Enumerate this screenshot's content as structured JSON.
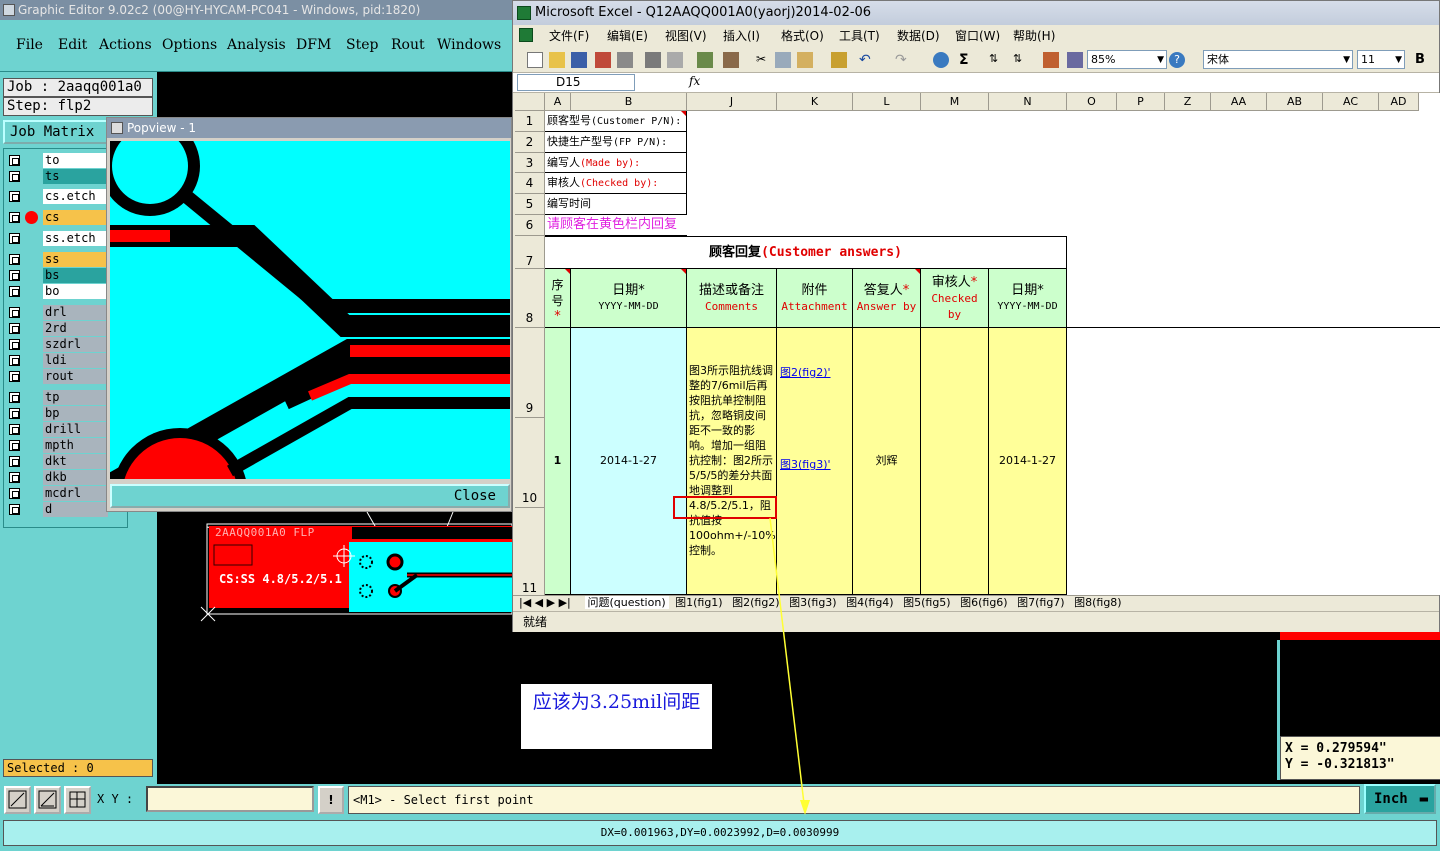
{
  "graphic_editor": {
    "title": "Graphic Editor 9.02c2 (00@HY-HYCAM-PC041 - Windows, pid:1820)",
    "menu": [
      "File",
      "Edit",
      "Actions",
      "Options",
      "Analysis",
      "DFM",
      "Step",
      "Rout",
      "Windows"
    ],
    "job_label": "Job : 2aaqq001a0",
    "step_label": "Step: flp2",
    "job_matrix_label": "Job Matrix",
    "layers": [
      {
        "name": "to",
        "color": "#ffffff"
      },
      {
        "name": "ts",
        "color": "#2aa39f"
      },
      {
        "name": "cs.etch",
        "color": "#ffffff"
      },
      {
        "name": "cs",
        "color": "#f6c24a",
        "active": true
      },
      {
        "name": "ss.etch",
        "color": "#ffffff"
      },
      {
        "name": "ss",
        "color": "#f6c24a"
      },
      {
        "name": "bs",
        "color": "#2aa39f"
      },
      {
        "name": "bo",
        "color": "#ffffff"
      },
      {
        "name": "drl",
        "color": "#a9b4bd"
      },
      {
        "name": "2rd",
        "color": "#a9b4bd"
      },
      {
        "name": "szdrl",
        "color": "#a9b4bd"
      },
      {
        "name": "ldi",
        "color": "#a9b4bd"
      },
      {
        "name": "rout",
        "color": "#a9b4bd"
      },
      {
        "name": "tp",
        "color": "#a9b4bd"
      },
      {
        "name": "bp",
        "color": "#a9b4bd"
      },
      {
        "name": "drill",
        "color": "#a9b4bd"
      },
      {
        "name": "mpth",
        "color": "#a9b4bd"
      },
      {
        "name": "dkt",
        "color": "#a9b4bd"
      },
      {
        "name": "dkb",
        "color": "#a9b4bd"
      },
      {
        "name": "mcdrl",
        "color": "#a9b4bd"
      },
      {
        "name": "d",
        "color": "#a9b4bd"
      }
    ],
    "selected_label": "Selected : 0",
    "popview_title": "Popview - 1",
    "popview_close": "Close",
    "board_silkscreen_1": "2AAQQ001A0 FLP",
    "board_silkscreen_2": "CS:SS 4.8/5.2/5.1",
    "xy_label": "X Y :",
    "xy_value": "",
    "bang_label": "!",
    "prompt": "<M1> - Select first point",
    "unit": "Inch",
    "status": "DX=0.001963,DY=0.0023992,D=0.0030999",
    "coord_x": "X = 0.279594\"",
    "coord_y": "Y = -0.321813\"",
    "note": "应该为3.25mil间距"
  },
  "excel": {
    "title": "Microsoft Excel - Q12AAQQ001A0(yaorj)2014-02-06",
    "menu": [
      "文件(F)",
      "编辑(E)",
      "视图(V)",
      "插入(I)",
      "格式(O)",
      "工具(T)",
      "数据(D)",
      "窗口(W)",
      "帮助(H)"
    ],
    "zoom": "85%",
    "font_name": "宋体",
    "font_size": "11",
    "bold_label": "B",
    "name_box": "D15",
    "fx": "fx",
    "columns": [
      "A",
      "B",
      "J",
      "K",
      "L",
      "M",
      "N",
      "O",
      "P",
      "Z",
      "AA",
      "AB",
      "AC",
      "AD"
    ],
    "rows": [
      "1",
      "2",
      "3",
      "4",
      "5",
      "6",
      "7",
      "8",
      "9",
      "10",
      "11"
    ],
    "info_labels": {
      "r1_a": "顾客型号",
      "r1_b": "(Customer P/N):",
      "r2_a": "快捷生产型号",
      "r2_b": "(FP P/N):",
      "r3_a": "编写人",
      "r3_b": "(Made by):",
      "r4_a": "审核人",
      "r4_b": "(Checked by):",
      "r5": "编写时间",
      "r6": "请顾客在黄色栏内回复"
    },
    "answers_title_cn": "顾客回复",
    "answers_title_en": "(Customer answers)",
    "headers": {
      "seq": "序号",
      "date_cn": "日期*",
      "date_fmt": "YYYY-MM-DD",
      "desc_cn": "描述或备注",
      "desc_en": "Comments",
      "att_cn": "附件",
      "att_en": "Attachment",
      "ans_cn": "答复人",
      "ans_en": "Answer by",
      "chk_cn": "审核人",
      "chk_en": "Checked by",
      "date2_cn": "日期*",
      "date2_fmt": "YYYY-MM-DD"
    },
    "row": {
      "seq": "1",
      "date": "2014-1-27",
      "comment_part1": "图3所示阻抗线调整的7/6mil后再按阻抗单控制阻抗，忽略铜皮间距不一致的影响。增加一组阻抗控制：图2所示5/5/5的差分共面地调整到",
      "comment_highlight": "4.8/5.2/5.1，",
      "comment_part2": "阻抗值按100ohm+/-10%控制。",
      "att1": "图2(fig2)'",
      "att2": "图3(fig3)'",
      "answer_by": "刘辉",
      "date2": "2014-1-27"
    },
    "tabs": [
      "问题(question)",
      "图1(fig1)",
      "图2(fig2)",
      "图3(fig3)",
      "图4(fig4)",
      "图5(fig5)",
      "图6(fig6)",
      "图7(fig7)",
      "图8(fig8)"
    ],
    "status": "就绪"
  },
  "colors": {
    "genesis_cyan": "#6ed3d0",
    "board_cyan": "#00ffff",
    "trace_red": "#ff0000",
    "excel_yellow": "#ffff99",
    "excel_green": "#ccffcc",
    "excel_cyan": "#ccffff",
    "annotation_yellow": "#ffff33",
    "annotation_red": "#e00000"
  }
}
